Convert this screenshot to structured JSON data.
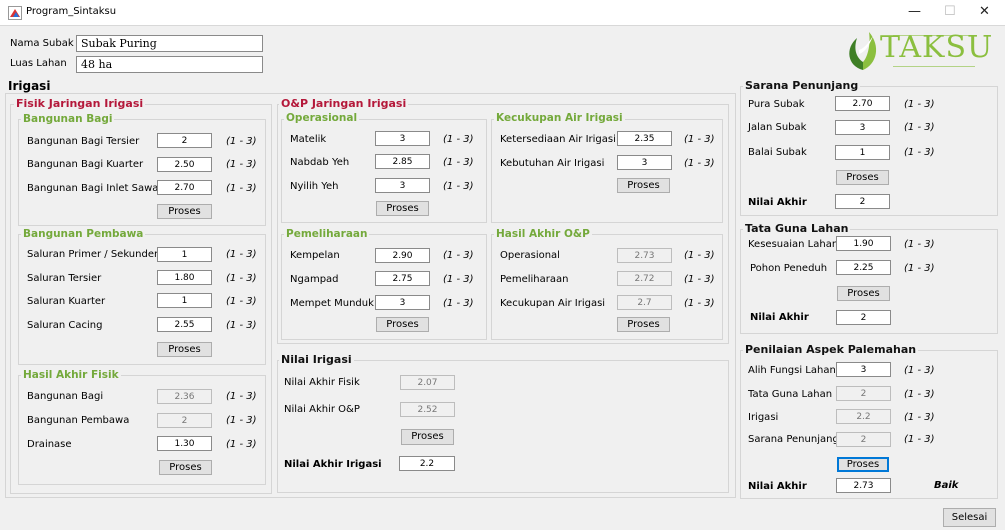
{
  "window": {
    "title": "Program_Sintaksu",
    "minimize_glyph": "—",
    "maximize_glyph": "☐",
    "close_glyph": "✕"
  },
  "header": {
    "nama_subak_label": "Nama Subak",
    "nama_subak_value": "Subak Puring",
    "luas_lahan_label": "Luas Lahan",
    "luas_lahan_value": "48 ha",
    "logo_text": "TAKSU",
    "logo_icon": "leaf-icon"
  },
  "irigasi": {
    "title": "Irigasi",
    "fisik": {
      "title": "Fisik Jaringan Irigasi",
      "bagi": {
        "title": "Bangunan Bagi",
        "rows": [
          {
            "label": "Bangunan Bagi Tersier",
            "value": "2",
            "range": "(1 - 3)"
          },
          {
            "label": "Bangunan Bagi Kuarter",
            "value": "2.50",
            "range": "(1 - 3)"
          },
          {
            "label": "Bangunan Bagi Inlet Sawah",
            "value": "2.70",
            "range": "(1 - 3)"
          }
        ],
        "button": "Proses"
      },
      "pembawa": {
        "title": "Bangunan Pembawa",
        "rows": [
          {
            "label": "Saluran Primer / Sekunder",
            "value": "1",
            "range": "(1 - 3)"
          },
          {
            "label": "Saluran Tersier",
            "value": "1.80",
            "range": "(1 - 3)"
          },
          {
            "label": "Saluran Kuarter",
            "value": "1",
            "range": "(1 - 3)"
          },
          {
            "label": "Saluran Cacing",
            "value": "2.55",
            "range": "(1 - 3)"
          }
        ],
        "button": "Proses"
      },
      "hasil": {
        "title": "Hasil Akhir Fisik",
        "rows": [
          {
            "label": "Bangunan Bagi",
            "value": "2.36",
            "range": "(1 - 3)"
          },
          {
            "label": "Bangunan Pembawa",
            "value": "2",
            "range": "(1 - 3)"
          },
          {
            "label": "Drainase",
            "value": "1.30",
            "range": "(1 - 3)"
          }
        ],
        "button": "Proses"
      }
    },
    "op": {
      "title": "O&P Jaringan Irigasi",
      "operasional": {
        "title": "Operasional",
        "rows": [
          {
            "label": "Matelik",
            "value": "3",
            "range": "(1 - 3)"
          },
          {
            "label": "Nabdab Yeh",
            "value": "2.85",
            "range": "(1 - 3)"
          },
          {
            "label": "Nyilih Yeh",
            "value": "3",
            "range": "(1 - 3)"
          }
        ],
        "button": "Proses"
      },
      "kecukupan": {
        "title": "Kecukupan Air Irigasi",
        "rows": [
          {
            "label": "Ketersediaan Air Irigasi",
            "value": "2.35",
            "range": "(1 - 3)"
          },
          {
            "label": "Kebutuhan Air Irigasi",
            "value": "3",
            "range": "(1 - 3)"
          }
        ],
        "button": "Proses"
      },
      "pemeliharaan": {
        "title": "Pemeliharaan",
        "rows": [
          {
            "label": "Kempelan",
            "value": "2.90",
            "range": "(1 - 3)"
          },
          {
            "label": "Ngampad",
            "value": "2.75",
            "range": "(1 - 3)"
          },
          {
            "label": "Mempet Munduk",
            "value": "3",
            "range": "(1 - 3)"
          }
        ],
        "button": "Proses"
      },
      "hasil": {
        "title": "Hasil Akhir O&P",
        "rows": [
          {
            "label": "Operasional",
            "value": "2.73",
            "range": "(1 - 3)"
          },
          {
            "label": "Pemeliharaan",
            "value": "2.72",
            "range": "(1 - 3)"
          },
          {
            "label": "Kecukupan Air Irigasi",
            "value": "2.7",
            "range": "(1 - 3)"
          }
        ],
        "button": "Proses"
      }
    },
    "nilai": {
      "title": "Nilai Irigasi",
      "fisik_label": "Nilai Akhir Fisik",
      "fisik_value": "2.07",
      "op_label": "Nilai Akhir O&P",
      "op_value": "2.52",
      "button": "Proses",
      "akhir_label": "Nilai Akhir Irigasi",
      "akhir_value": "2.2"
    }
  },
  "sarana": {
    "title": "Sarana Penunjang",
    "rows": [
      {
        "label": "Pura Subak",
        "value": "2.70",
        "range": "(1 - 3)"
      },
      {
        "label": "Jalan Subak",
        "value": "3",
        "range": "(1 - 3)"
      },
      {
        "label": "Balai Subak",
        "value": "1",
        "range": "(1 - 3)"
      }
    ],
    "button": "Proses",
    "akhir_label": "Nilai Akhir",
    "akhir_value": "2"
  },
  "tata": {
    "title": "Tata Guna Lahan",
    "rows": [
      {
        "label": "Kesesuaian Lahan",
        "value": "1.90",
        "range": "(1 - 3)"
      },
      {
        "label": "Pohon Peneduh",
        "value": "2.25",
        "range": "(1 - 3)"
      }
    ],
    "button": "Proses",
    "akhir_label": "Nilai Akhir",
    "akhir_value": "2"
  },
  "palemahan": {
    "title": "Penilaian Aspek Palemahan",
    "rows": [
      {
        "label": "Alih Fungsi Lahan",
        "value": "3",
        "range": "(1 - 3)"
      },
      {
        "label": "Tata Guna Lahan",
        "value": "2",
        "range": "(1 - 3)"
      },
      {
        "label": "Irigasi",
        "value": "2.2",
        "range": "(1 - 3)"
      },
      {
        "label": "Sarana Penunjang",
        "value": "2",
        "range": "(1 - 3)"
      }
    ],
    "button": "Proses",
    "akhir_label": "Nilai Akhir",
    "akhir_value": "2.73",
    "result": "Baik"
  },
  "footer": {
    "selesai": "Selesai"
  },
  "colors": {
    "fisik_title": "#b4183a",
    "sub_title": "#74a93b",
    "logo_green": "#8bbf3f",
    "focus_border": "#0078d7"
  }
}
